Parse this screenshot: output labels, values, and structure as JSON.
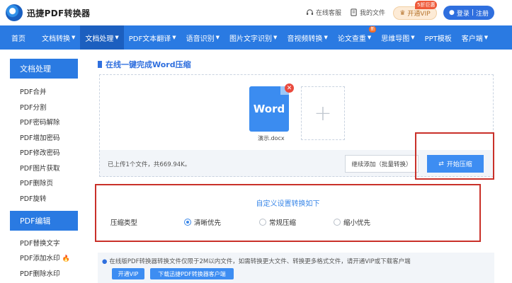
{
  "header": {
    "logo_text": "迅捷PDF转换器",
    "service": "在线客服",
    "my_files": "我的文件",
    "vip": "开通VIP",
    "vip_tag": "5折巨惠",
    "login": "登录",
    "register": "注册"
  },
  "nav": {
    "items": [
      {
        "label": "首页",
        "caret": false
      },
      {
        "label": "文档转换",
        "caret": true
      },
      {
        "label": "文档处理",
        "caret": true,
        "active": true
      },
      {
        "label": "PDF文本翻译",
        "caret": true
      },
      {
        "label": "语音识别",
        "caret": true
      },
      {
        "label": "图片文字识别",
        "caret": true
      },
      {
        "label": "音视频转换",
        "caret": true
      },
      {
        "label": "论文查重",
        "caret": true,
        "badge": "新"
      },
      {
        "label": "思维导图",
        "caret": true
      },
      {
        "label": "PPT模板",
        "caret": false
      },
      {
        "label": "客户端",
        "caret": true
      }
    ]
  },
  "sidebar": {
    "section1": "文档处理",
    "items1": [
      "PDF合并",
      "PDF分割",
      "PDF密码解除",
      "PDF增加密码",
      "PDF修改密码",
      "PDF图片获取",
      "PDF删除页",
      "PDF旋转"
    ],
    "section2": "PDF编辑",
    "items2": [
      "PDF替换文字",
      "PDF添加水印",
      "PDF删除水印"
    ]
  },
  "main": {
    "title": "在线一键完成Word压缩",
    "file_icon_text": "Word",
    "file_name": "演示.docx",
    "upload_info": "已上传1个文件，共669.94K。",
    "continue_btn": "继续添加（批量转换）",
    "start_btn": "开始压缩"
  },
  "settings": {
    "title": "自定义设置转换如下",
    "label": "压缩类型",
    "options": [
      "清晰优先",
      "常规压缩",
      "缩小优先"
    ],
    "selected": "清晰优先"
  },
  "notice": {
    "text": "在线版PDF转换器转换文件仅限于2M以内文件，如需转换更大文件、转换更多格式文件，请开通VIP或下载客户端",
    "vip_btn": "开通VIP",
    "download_btn": "下载迅捷PDF转换器客户端"
  },
  "colors": {
    "nav_bg": "#2a7ae2",
    "accent": "#3d8df2",
    "highlight_box": "#c93029"
  }
}
